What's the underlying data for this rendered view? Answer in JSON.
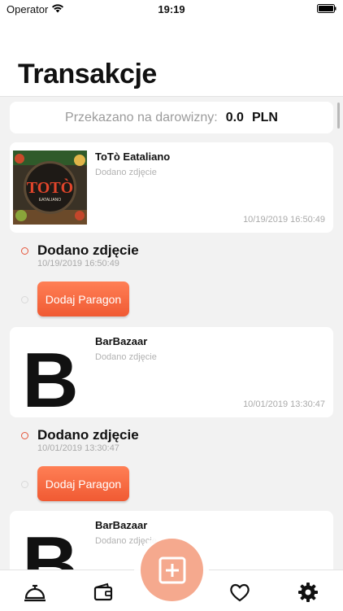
{
  "status_bar": {
    "carrier": "Operator",
    "time": "19:19"
  },
  "header": {
    "title": "Transakcje"
  },
  "donation": {
    "label": "Przekazano na darowizny:",
    "value": "0.0",
    "currency": "PLN"
  },
  "transactions": [
    {
      "name": "ToTò Eataliano",
      "status": "Dodano zdjęcie",
      "date": "10/19/2019 16:50:49",
      "timeline": {
        "label": "Dodano zdjęcie",
        "date": "10/19/2019 16:50:49"
      },
      "action_label": "Dodaj Paragon"
    },
    {
      "name": "BarBazaar",
      "status": "Dodano zdjęcie",
      "date": "10/01/2019 13:30:47",
      "timeline": {
        "label": "Dodano zdjęcie",
        "date": "10/01/2019 13:30:47"
      },
      "action_label": "Dodaj Paragon"
    },
    {
      "name": "BarBazaar",
      "status": "Dodano zdjęcie"
    }
  ],
  "tabs": [
    {
      "icon": "service-bell-icon"
    },
    {
      "icon": "wallet-icon"
    },
    {
      "icon": "add-receipt-icon"
    },
    {
      "icon": "heart-icon"
    },
    {
      "icon": "gear-icon"
    }
  ],
  "colors": {
    "accent": "#f05a33",
    "fab": "#f5a98e",
    "background": "#f2f2f2"
  }
}
